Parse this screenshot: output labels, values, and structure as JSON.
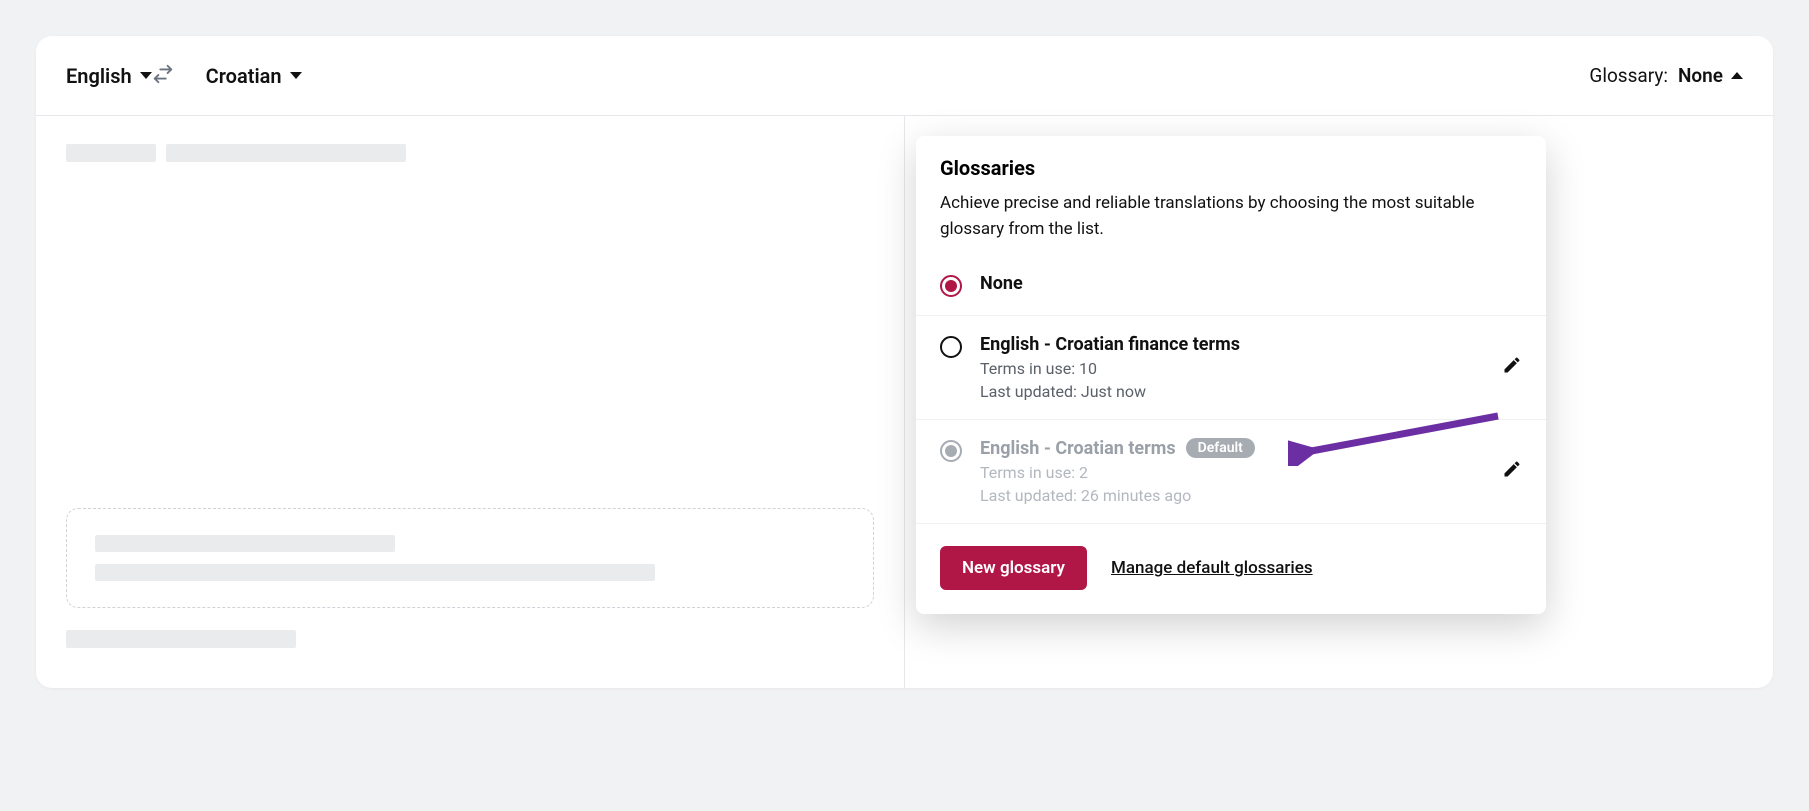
{
  "source_language": "English",
  "target_language": "Croatian",
  "glossary_label": "Glossary:",
  "glossary_value": "None",
  "panel": {
    "heading": "Glossaries",
    "description": "Achieve precise and reliable translations by choosing the most suitable glossary from the list.",
    "options": [
      {
        "title": "None",
        "selected": true
      },
      {
        "title": "English - Croatian finance terms",
        "terms": "Terms in use: 10",
        "updated": "Last updated: Just now"
      },
      {
        "title": "English - Croatian terms",
        "terms": "Terms in use: 2",
        "updated": "Last updated: 26 minutes ago",
        "badge": "Default"
      }
    ],
    "new_button": "New glossary",
    "manage_link": "Manage default glossaries"
  }
}
